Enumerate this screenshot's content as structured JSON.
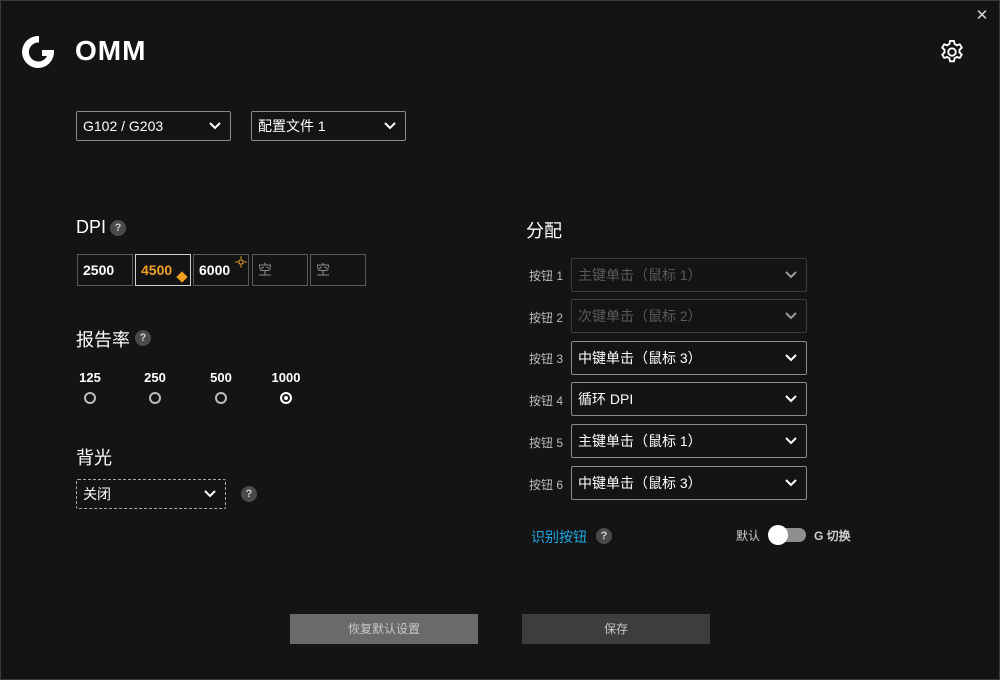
{
  "header": {
    "title": "OMM",
    "close_symbol": "✕"
  },
  "device_select": {
    "value": "G102 / G203"
  },
  "profile_select": {
    "value": "配置文件 1"
  },
  "dpi": {
    "title": "DPI",
    "help": "?",
    "levels": [
      "2500",
      "4500",
      "6000",
      "空",
      "空"
    ],
    "active_index": 1,
    "default_index": 1,
    "shift_index": 2
  },
  "report_rate": {
    "title": "报告率",
    "help": "?",
    "options": [
      "125",
      "250",
      "500",
      "1000"
    ],
    "selected": "1000"
  },
  "backlight": {
    "title": "背光",
    "help": "?",
    "value": "关闭"
  },
  "assignment": {
    "title": "分配",
    "buttons": [
      {
        "label": "按钮 1",
        "value": "主键单击（鼠标 1）",
        "disabled": true
      },
      {
        "label": "按钮 2",
        "value": "次键单击（鼠标 2）",
        "disabled": true
      },
      {
        "label": "按钮 3",
        "value": "中键单击（鼠标 3）",
        "disabled": false
      },
      {
        "label": "按钮 4",
        "value": "循环 DPI",
        "disabled": false
      },
      {
        "label": "按钮 5",
        "value": "主键单击（鼠标 1）",
        "disabled": false
      },
      {
        "label": "按钮 6",
        "value": "中键单击（鼠标 3）",
        "disabled": false
      }
    ],
    "identify_link": "识别按钮",
    "help": "?",
    "toggle_left": "默认",
    "toggle_right": "G 切换",
    "g_shift_enabled": false
  },
  "actions": {
    "reset_label": "恢复默认设置",
    "save_label": "保存"
  },
  "colors": {
    "background": "#141414",
    "accent_orange": "#f0a020",
    "link_blue": "#1ea8e6"
  }
}
